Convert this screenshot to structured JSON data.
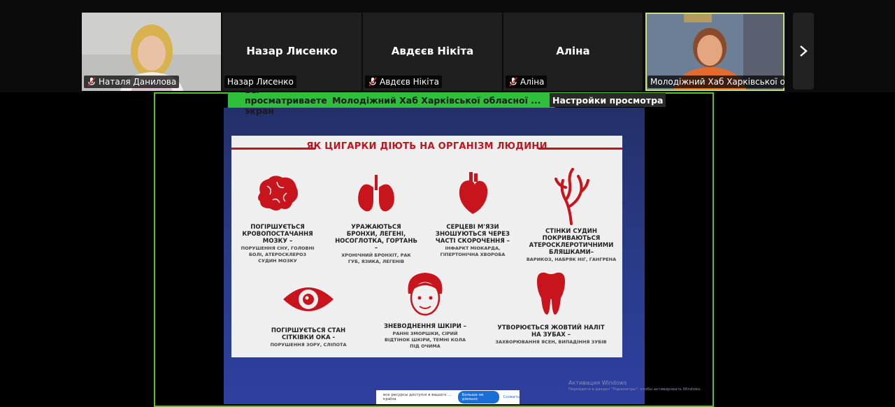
{
  "participants": [
    {
      "name": "Наталя Данилова",
      "has_video": true,
      "muted": true
    },
    {
      "name": "Назар Лисенко",
      "display": "Назар Лисенко",
      "has_video": false,
      "muted": false
    },
    {
      "name": "Авдєєв Нікіта",
      "display": "Авдєєв Нікіта",
      "has_video": false,
      "muted": true
    },
    {
      "name": "Аліна",
      "display": "Аліна",
      "has_video": false,
      "muted": true
    },
    {
      "name": "Молодіжний Хаб Харківської об...",
      "has_video": true,
      "muted": false,
      "active_speaker": true
    }
  ],
  "banner": {
    "viewing_text": "Вы просматриваете экран",
    "sharer": "Молодіжний Хаб Харківської обласної ...",
    "view_settings": "Настройки просмотра"
  },
  "slide": {
    "title": "ЯК ЦИГАРКИ ДІЮТЬ НА ОРГАНІЗМ ЛЮДИНИ",
    "items": [
      {
        "icon": "brain-icon",
        "heading": "ПОГІРШУЄТЬСЯ КРОВОПОСТАЧАННЯ МОЗКУ –",
        "sub": "ПОРУШЕННЯ СНУ, ГОЛОВНІ БОЛІ, АТЕРОСКЛЕРОЗ СУДИН МОЗКУ"
      },
      {
        "icon": "lungs-icon",
        "heading": "УРАЖАЮТЬСЯ БРОНХИ, ЛЕГЕНІ, НОСОГЛОТКА, ГОРТАНЬ –",
        "sub": "ХРОНІЧНИЙ БРОНХІТ, РАК ГУБ, ЯЗИКА, ЛЕГЕНІВ"
      },
      {
        "icon": "heart-icon",
        "heading": "СЕРЦЕВІ М'ЯЗИ ЗНОШУЮТЬСЯ ЧЕРЕЗ ЧАСТІ СКОРОЧЕННЯ –",
        "sub": "ІНФАРКТ МІОКАРДА, ГІПЕРТОНІЧНА ХВОРОБА"
      },
      {
        "icon": "blood-vessels-icon",
        "heading": "СТІНКИ СУДИН ПОКРИВАЮТЬСЯ АТЕРОСКЛЕРОТИЧНИМИ БЛЯШКАМИ–",
        "sub": "ВАРИКОЗ, НАБРЯК НІГ, ГАНГРЕНА"
      },
      {
        "icon": "eye-icon",
        "heading": "ПОГІРШУЄТЬСЯ СТАН СІТКІВКИ ОКА -",
        "sub": "ПОРУШЕННЯ ЗОРУ, СЛІПОТА"
      },
      {
        "icon": "face-icon",
        "heading": "ЗНЕВОДНЕННЯ ШКІРИ –",
        "sub": "РАННІ ЗМОРШКИ, СІРИЙ ВІДТІНОК ШКІРИ, ТЕМНІ КОЛА ПІД ОЧИМА"
      },
      {
        "icon": "tooth-icon",
        "heading": "УТВОРЮЄТЬСЯ ЖОВТИЙ НАЛІТ НА ЗУБАХ –",
        "sub": "ЗАХВОРЮВАННЯ ЯСЕН, ВИПАДІННЯ ЗУБІВ"
      }
    ]
  },
  "cookie_bar": {
    "text": "все ресурсы доступні в вашого ... країна",
    "accept": "Больше не діяльно",
    "link": "Сховать"
  },
  "windows_activation": {
    "title": "Активация Windows",
    "sub": "Перейдите в раздел \"Параметры\", чтобы активировать Windows."
  },
  "colors": {
    "accent_green": "#2fbf3a",
    "slide_red": "#c0151c",
    "slide_blue": "#2a3c8c"
  }
}
